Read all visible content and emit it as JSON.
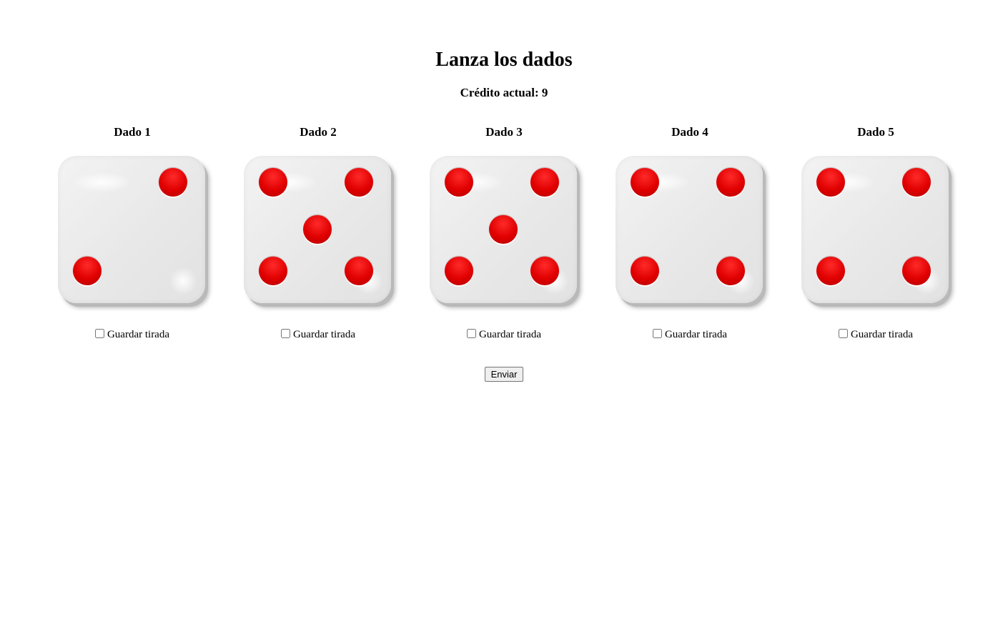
{
  "title": "Lanza los dados",
  "credit": "Crédito actual: 9",
  "keep_label": "Guardar tirada",
  "submit_label": "Enviar",
  "pip_color": "#e00000",
  "dice": [
    {
      "label": "Dado 1",
      "value": 2
    },
    {
      "label": "Dado 2",
      "value": 5
    },
    {
      "label": "Dado 3",
      "value": 5
    },
    {
      "label": "Dado 4",
      "value": 4
    },
    {
      "label": "Dado 5",
      "value": 4
    }
  ]
}
